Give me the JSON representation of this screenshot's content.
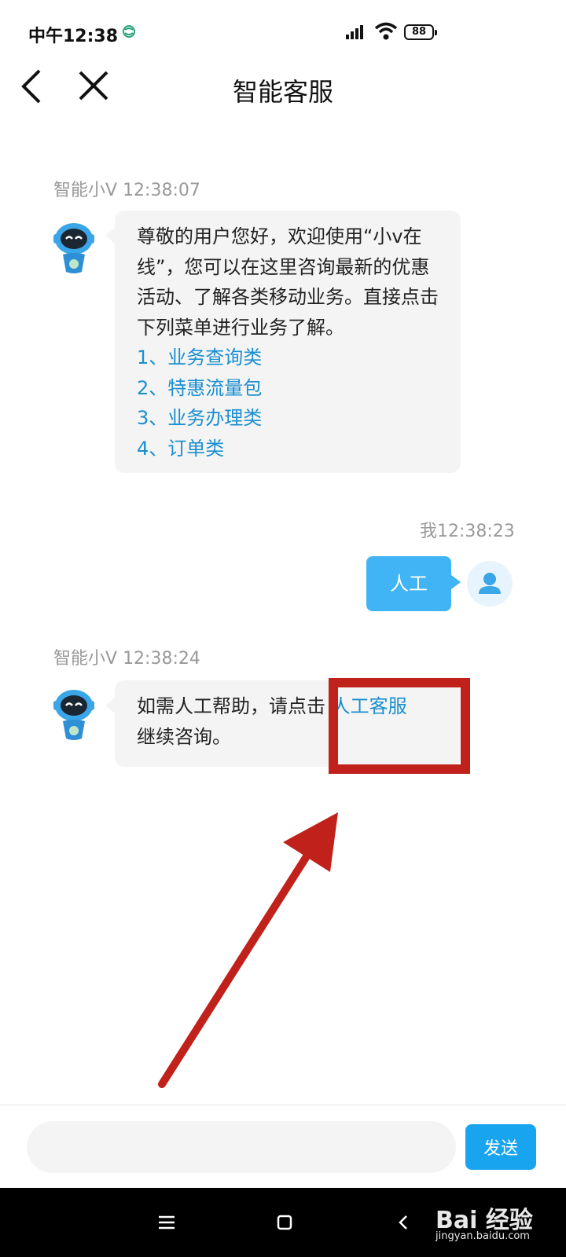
{
  "status_bar": {
    "time": "中午12:38",
    "battery": "88"
  },
  "header": {
    "title": "智能客服"
  },
  "messages": [
    {
      "sender": "智能小V",
      "time": "12:38:07",
      "text": "尊敬的用户您好，欢迎使用“小v在线”，您可以在这里咨询最新的优惠活动、了解各类移动业务。直接点击下列菜单进行业务了解。",
      "menu": [
        "1、业务查询类",
        "2、特惠流量包",
        "3、业务办理类",
        "4、订单类"
      ]
    },
    {
      "sender_time": "我12:38:23",
      "text": "人工"
    },
    {
      "sender": "智能小V",
      "time": "12:38:24",
      "text_before": "如需人工帮助，请点击 ",
      "link": "人工客服",
      "text_after": "继续咨询。"
    }
  ],
  "input": {
    "placeholder": "",
    "send_label": "发送"
  },
  "watermark": {
    "main": "Bai 经验",
    "sub": "jingyan.baidu.com"
  },
  "colors": {
    "accent": "#18a4ef",
    "link": "#1a8fd0",
    "annotation": "#c0211b",
    "bubble_out": "#40b4f5"
  }
}
